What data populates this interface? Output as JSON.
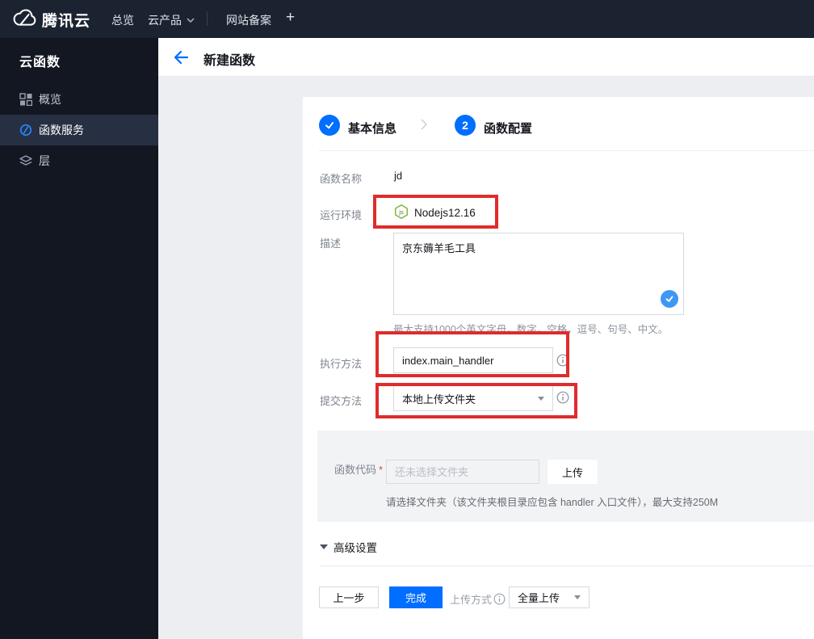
{
  "topnav": {
    "brand": "腾讯云",
    "overview": "总览",
    "products": "云产品",
    "beian": "网站备案",
    "add_tab": "+"
  },
  "sidebar": {
    "title": "云函数",
    "items": [
      {
        "label": "概览",
        "icon": "grid-icon",
        "active": false
      },
      {
        "label": "函数服务",
        "icon": "function-service-icon",
        "active": true
      },
      {
        "label": "层",
        "icon": "layers-icon",
        "active": false
      }
    ]
  },
  "header": {
    "title": "新建函数"
  },
  "stepper": {
    "step1_label": "基本信息",
    "step2_number": "2",
    "step2_label": "函数配置"
  },
  "form": {
    "name_label": "函数名称",
    "name_value": "jd",
    "runtime_label": "运行环境",
    "runtime_value": "Nodejs12.16",
    "desc_label": "描述",
    "desc_value": "京东薅羊毛工具",
    "desc_helper": "最大支持1000个英文字母，数字，空格，逗号、句号、中文。",
    "handler_label": "执行方法",
    "handler_value": "index.main_handler",
    "submit_label": "提交方法",
    "submit_value": "本地上传文件夹",
    "code_label": "函数代码",
    "required_mark": "*",
    "code_placeholder": "还未选择文件夹",
    "upload_button": "上传",
    "code_helper": "请选择文件夹（该文件夹根目录应包含 handler 入口文件），最大支持250M",
    "advanced_toggle": "高级设置"
  },
  "footer": {
    "prev_button": "上一步",
    "finish_button": "完成",
    "upload_mode_label": "上传方式",
    "upload_mode_value": "全量上传"
  },
  "colors": {
    "accent_blue": "#006eff",
    "annotation_red": "#e02b2b",
    "node_green": "#7fb83d",
    "check_blue": "#3f97f5",
    "topnav_bg": "#1b2230",
    "sidebar_bg": "#121722"
  }
}
